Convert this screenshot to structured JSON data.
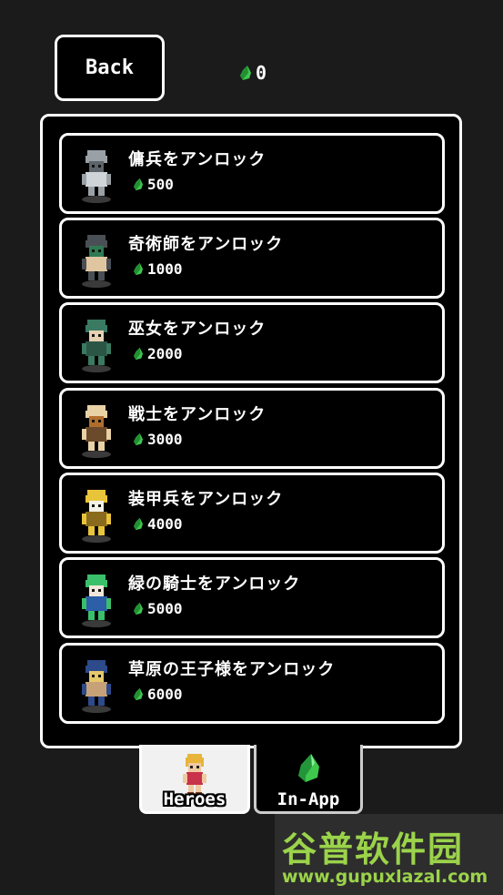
{
  "header": {
    "back_label": "Back",
    "gem_count": "0"
  },
  "heroes": [
    {
      "title": "傭兵をアンロック",
      "price": "500",
      "icon": "mercenary-icon",
      "colors": [
        "#9aa1a6",
        "#5d646a",
        "#cfd4d8"
      ]
    },
    {
      "title": "奇術師をアンロック",
      "price": "1000",
      "icon": "magician-icon",
      "colors": [
        "#4a4f55",
        "#2f7a52",
        "#e0c6a0"
      ]
    },
    {
      "title": "巫女をアンロック",
      "price": "2000",
      "icon": "shrine-maiden-icon",
      "colors": [
        "#3a7a62",
        "#e6d0b2",
        "#2b5646"
      ]
    },
    {
      "title": "戦士をアンロック",
      "price": "3000",
      "icon": "warrior-icon",
      "colors": [
        "#e9d1a6",
        "#b06e2c",
        "#6a4a2a"
      ]
    },
    {
      "title": "装甲兵をアンロック",
      "price": "4000",
      "icon": "armored-soldier-icon",
      "colors": [
        "#e8c43a",
        "#f1f1e8",
        "#8a6a1c"
      ]
    },
    {
      "title": "緑の騎士をアンロック",
      "price": "5000",
      "icon": "green-knight-icon",
      "colors": [
        "#3ac06a",
        "#f0e6da",
        "#2d5ea8"
      ]
    },
    {
      "title": "草原の王子様をアンロック",
      "price": "6000",
      "icon": "prairie-prince-icon",
      "colors": [
        "#2d4a8a",
        "#e5c86a",
        "#c7a278"
      ]
    }
  ],
  "tabs": [
    {
      "label": "Heroes",
      "icon": "hero-sprite-icon"
    },
    {
      "label": "In-App",
      "icon": "green-gem-icon"
    }
  ],
  "watermark": {
    "title": "谷普软件园",
    "url": "www.gupuxlazal.com"
  },
  "colors": {
    "gem": "#3ec84e",
    "background": "#1b1b1b",
    "panel": "#000000",
    "border": "#ffffff",
    "watermark": "#9bd34a"
  }
}
